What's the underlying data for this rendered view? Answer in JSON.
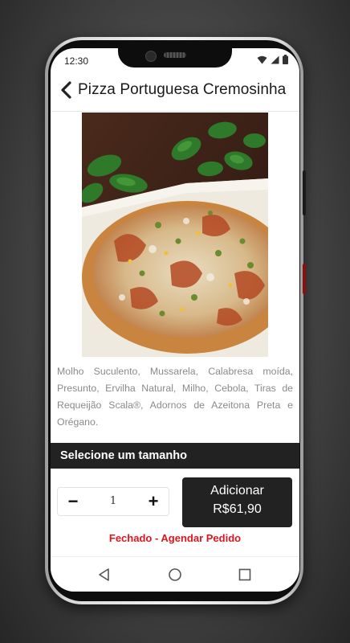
{
  "status_bar": {
    "time": "12:30"
  },
  "header": {
    "title": "Pizza Portuguesa Cremosinha"
  },
  "product": {
    "description": "Molho Suculento, Mussarela, Calabresa moída, Presunto, Ervilha Natural, Milho, Cebola, Tiras de Requeijão Scala®, Adornos de Azeitona Preta e Orégano."
  },
  "size_section": {
    "label": "Selecione um tamanho"
  },
  "quantity": {
    "minus": "−",
    "value": "1",
    "plus": "+"
  },
  "add_button": {
    "label": "Adicionar",
    "price": "R$61,90"
  },
  "store_status": {
    "text": "Fechado - Agendar Pedido",
    "color": "#e0141e"
  },
  "icons": {
    "back": "chevron-left-icon",
    "wifi": "wifi-icon",
    "signal": "signal-icon",
    "battery": "battery-icon",
    "nav_back": "triangle-back-icon",
    "nav_home": "circle-home-icon",
    "nav_recent": "square-recent-icon"
  }
}
